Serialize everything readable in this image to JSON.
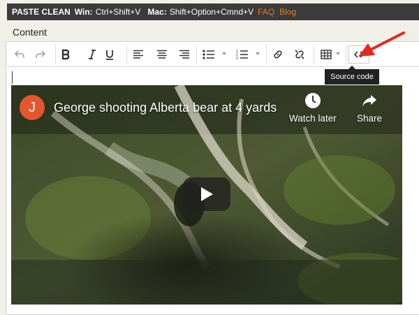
{
  "topbar": {
    "brand": "PASTE CLEAN",
    "win_label": "Win:",
    "win_keys": "Ctrl+Shift+V",
    "mac_label": "Mac:",
    "mac_keys": "Shift+Option+Cmnd+V",
    "faq": "FAQ",
    "blog": "Blog",
    "link_color": "#e07b2a"
  },
  "field_label": "Content",
  "toolbar": {
    "items": [
      "undo-icon",
      "redo-icon",
      "bold-icon",
      "italic-icon",
      "underline-icon",
      "align-left-icon",
      "align-center-icon",
      "align-right-icon",
      "bullet-list-icon",
      "numbered-list-icon",
      "link-icon",
      "unlink-icon",
      "table-icon",
      "source-code-icon"
    ],
    "tooltip": "Source code"
  },
  "video": {
    "channel_initial": "J",
    "title": "George shooting Alberta bear at 4 yards",
    "watch_later": "Watch later",
    "share": "Share",
    "avatar_color": "#e4572e"
  },
  "annotation": {
    "arrow_color": "#e02a1f"
  }
}
